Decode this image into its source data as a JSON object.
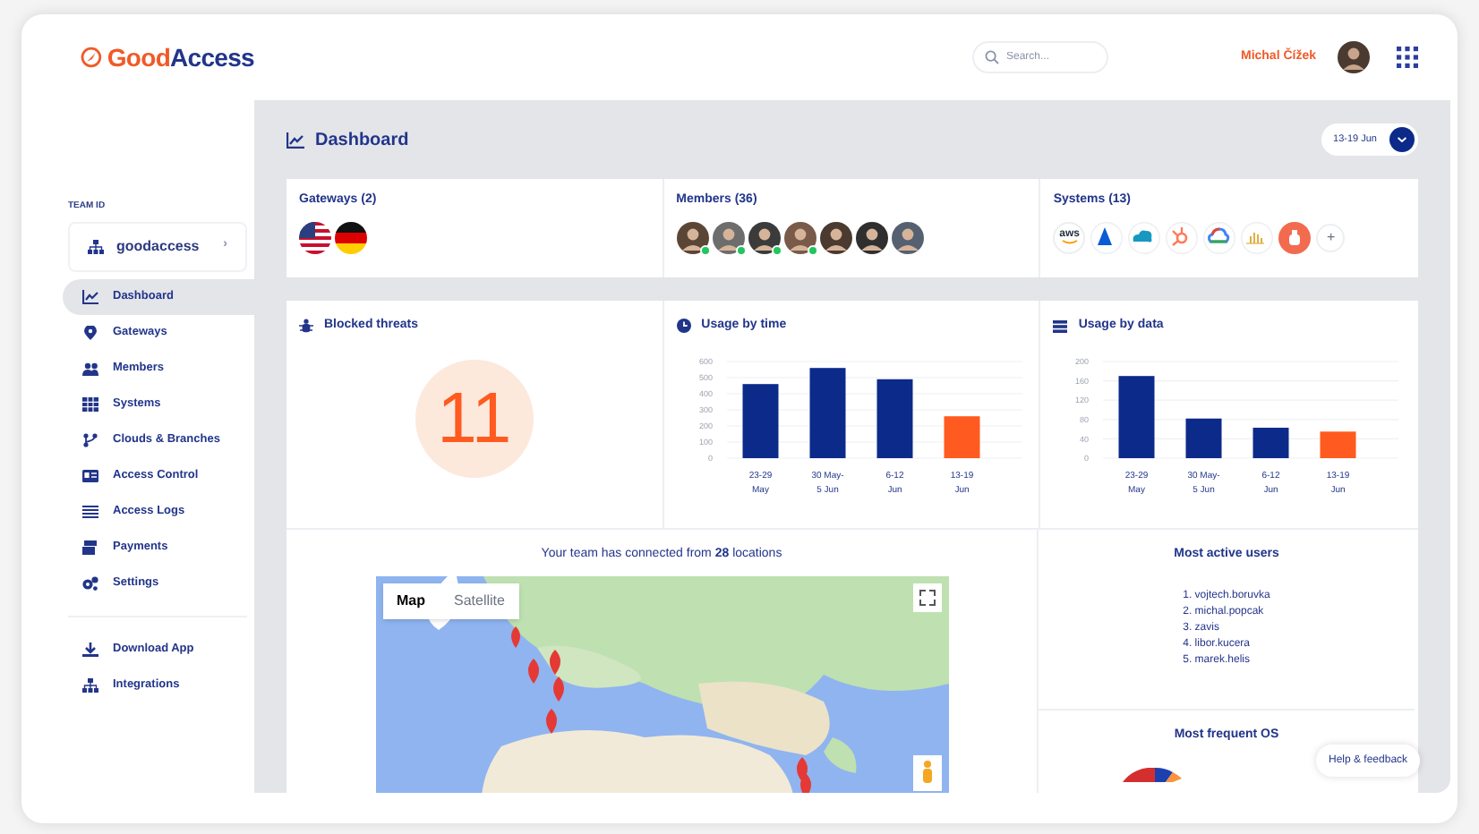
{
  "logo": {
    "part_1": "Good",
    "part_2": "Access"
  },
  "search": {
    "placeholder": "Search..."
  },
  "user": {
    "name": "Michal Čížek"
  },
  "sidebar": {
    "team_label": "TEAM ID",
    "team": "goodaccess",
    "team_arrow": "›",
    "items": [
      {
        "label": "Dashboard",
        "selected": true
      },
      {
        "label": "Gateways",
        "selected": false
      },
      {
        "label": "Members",
        "selected": false
      },
      {
        "label": "Systems",
        "selected": false
      },
      {
        "label": "Clouds & Branches",
        "selected": false
      },
      {
        "label": "Access Control",
        "selected": false
      },
      {
        "label": "Access Logs",
        "selected": false
      },
      {
        "label": "Payments",
        "selected": false
      },
      {
        "label": "Settings",
        "selected": false
      }
    ],
    "bottom_items": [
      {
        "label": "Download App",
        "selected": false
      },
      {
        "label": "Integrations",
        "selected": false
      }
    ]
  },
  "page": {
    "title": "Dashboard",
    "date_range": "13-19 Jun"
  },
  "gateways": {
    "title": "Gateways (2)",
    "items": [
      {
        "kind": "us"
      },
      {
        "kind": "de"
      }
    ]
  },
  "members": {
    "title": "Members (36)",
    "items": [
      {
        "online": true
      },
      {
        "online": true
      },
      {
        "online": true
      },
      {
        "online": true
      },
      {
        "online": false
      },
      {
        "online": false
      },
      {
        "online": false
      }
    ]
  },
  "systems": {
    "title": "Systems (13)",
    "items": [
      {
        "kind": "aws",
        "label": "aws"
      },
      {
        "kind": "azure"
      },
      {
        "kind": "salesforce"
      },
      {
        "kind": "hubspot"
      },
      {
        "kind": "gcloud"
      },
      {
        "kind": "chart"
      },
      {
        "kind": "custom"
      }
    ],
    "add": "+"
  },
  "blocked_threats": {
    "title": "Blocked threats",
    "count": "11"
  },
  "usage_by_time": {
    "title": "Usage by time",
    "chart_data": {
      "type": "bar",
      "categories": [
        "23-29 May",
        "30 May- 5 Jun",
        "6-12 Jun",
        "13-19 Jun"
      ],
      "series": [
        {
          "color": "#0b2a8a",
          "values": [
            460,
            560,
            490,
            null
          ]
        },
        {
          "color": "#ff5a1f",
          "values": [
            null,
            null,
            null,
            260
          ]
        }
      ],
      "stacked": true,
      "grid": true,
      "ylim": [
        0,
        600
      ],
      "yticks": [
        0,
        100,
        200,
        300,
        400,
        500,
        600
      ]
    }
  },
  "usage_by_data": {
    "title": "Usage by data",
    "chart_data": {
      "type": "bar",
      "categories": [
        "23-29 May",
        "30 May- 5 Jun",
        "6-12 Jun",
        "13-19 Jun"
      ],
      "series": [
        {
          "color": "#0b2a8a",
          "values": [
            170,
            82,
            63,
            null
          ]
        },
        {
          "color": "#ff5a1f",
          "values": [
            null,
            null,
            null,
            55
          ]
        }
      ],
      "stacked": true,
      "grid": true,
      "ylim": [
        0,
        200
      ],
      "yticks": [
        0,
        40,
        80,
        120,
        160,
        200
      ]
    }
  },
  "locations": {
    "text": "Your team has connected from **28** locations",
    "map_tabs": [
      {
        "label": "Map",
        "selected": true
      },
      {
        "label": "Satellite",
        "selected": false
      }
    ]
  },
  "most_active_users": {
    "title": "Most active users",
    "items": [
      "1. vojtech.boruvka",
      "2. michal.popcak",
      "3. zavis",
      "4. libor.kucera",
      "5. marek.helis"
    ]
  },
  "most_frequent_os": {
    "title": "Most frequent OS"
  },
  "help": {
    "label": "Help & feedback"
  }
}
